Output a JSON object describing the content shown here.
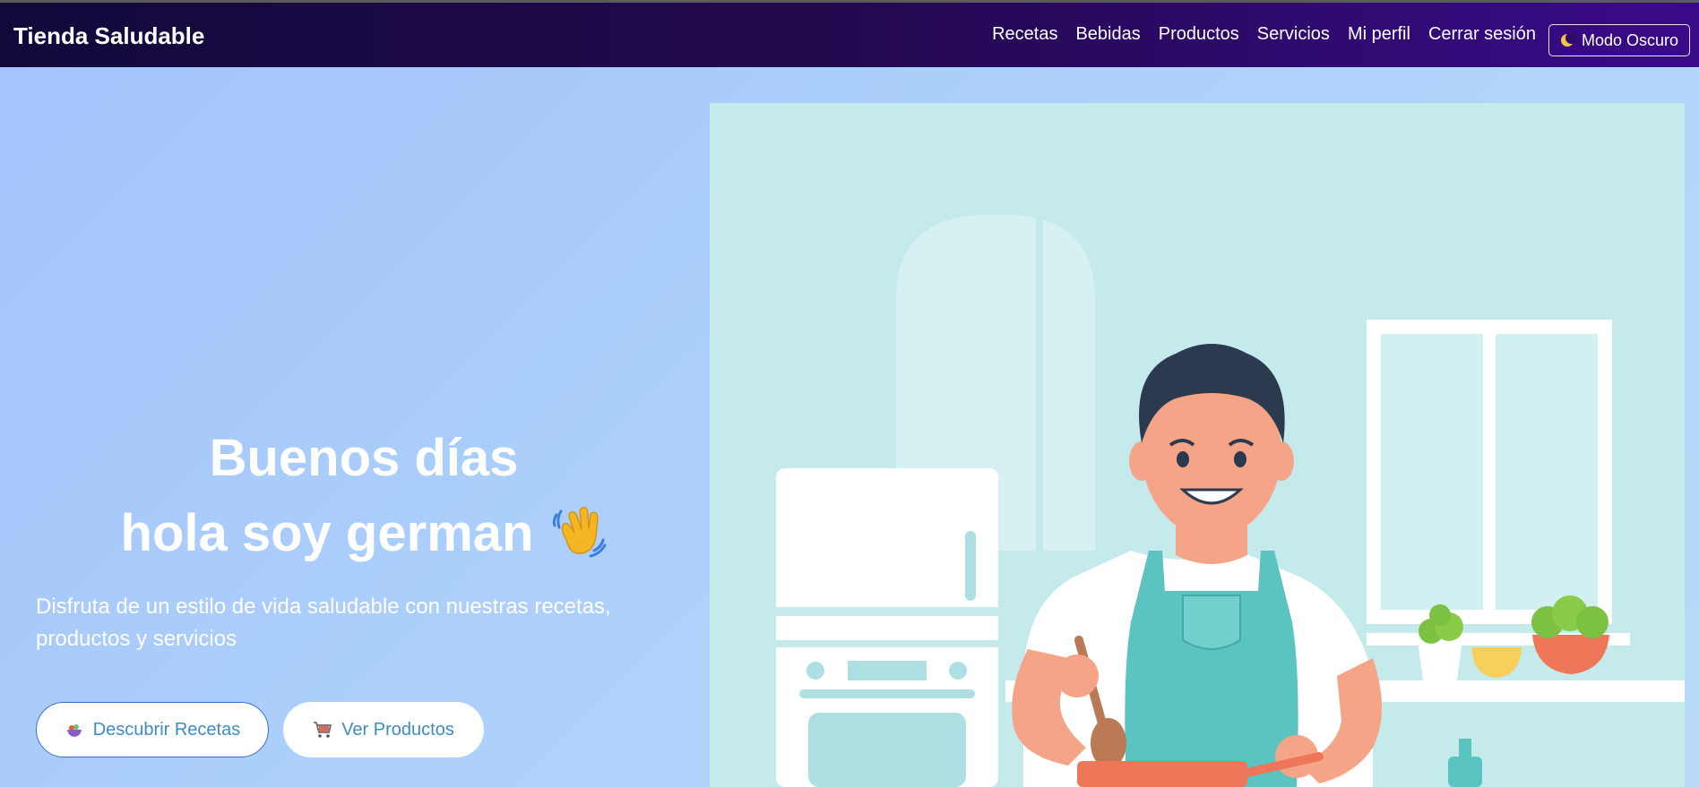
{
  "navbar": {
    "brand": "Tienda Saludable",
    "links": [
      "Recetas",
      "Bebidas",
      "Productos",
      "Servicios",
      "Mi perfil",
      "Cerrar sesión"
    ],
    "dark_mode_label": "Modo Oscuro"
  },
  "hero": {
    "greeting_line1": "Buenos días",
    "greeting_line2": "hola soy german",
    "subtitle": "Disfruta de un estilo de vida saludable con nuestras recetas, productos y servicios",
    "primary_button": "Descubrir Recetas",
    "secondary_button": "Ver Productos"
  },
  "colors": {
    "navbar_start": "#12093a",
    "navbar_end": "#3a0a8a",
    "background": "#a9cafb",
    "button_text": "#3f8cc0",
    "illustration_bg": "#c4eaec"
  },
  "icons": {
    "dark_mode": "moon-icon",
    "wave": "waving-hand-icon",
    "recipes": "bowl-icon",
    "products": "cart-icon"
  }
}
